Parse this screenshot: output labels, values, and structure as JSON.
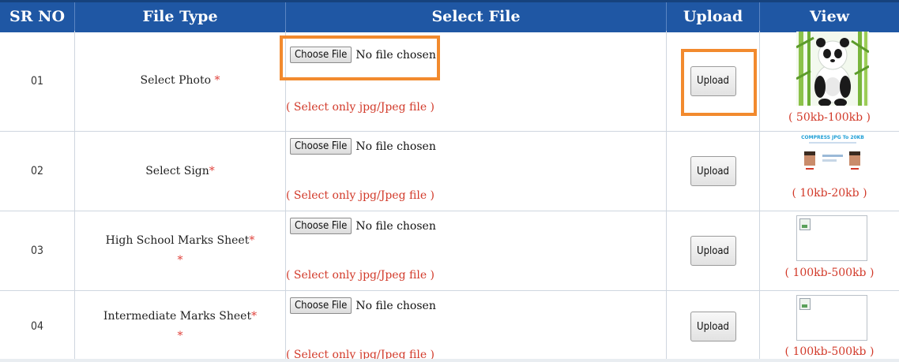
{
  "header": {
    "sr_no": "SR NO",
    "file_type": "File Type",
    "select_file": "Select File",
    "upload": "Upload",
    "view": "View"
  },
  "common": {
    "choose_file_label": "Choose File",
    "no_file_text": "No file chosen",
    "upload_label": "Upload",
    "hint": "( Select only jpg/Jpeg file )",
    "required_mark": "*"
  },
  "rows": [
    {
      "sr": "01",
      "file_type": "Select Photo",
      "size_hint": "( 50kb-100kb )"
    },
    {
      "sr": "02",
      "file_type": "Select Sign",
      "size_hint": "( 10kb-20kb )"
    },
    {
      "sr": "03",
      "file_type": "High School Marks Sheet",
      "size_hint": "( 100kb-500kb )"
    },
    {
      "sr": "04",
      "file_type": "Intermediate Marks Sheet",
      "size_hint": "( 100kb-500kb )"
    }
  ],
  "sample_sign": {
    "heading": "COMPRESS JPG To 20KB"
  },
  "colors": {
    "header_bg": "#1f57a4",
    "highlight": "#f28a2e",
    "hint_red": "#d23a2a"
  }
}
